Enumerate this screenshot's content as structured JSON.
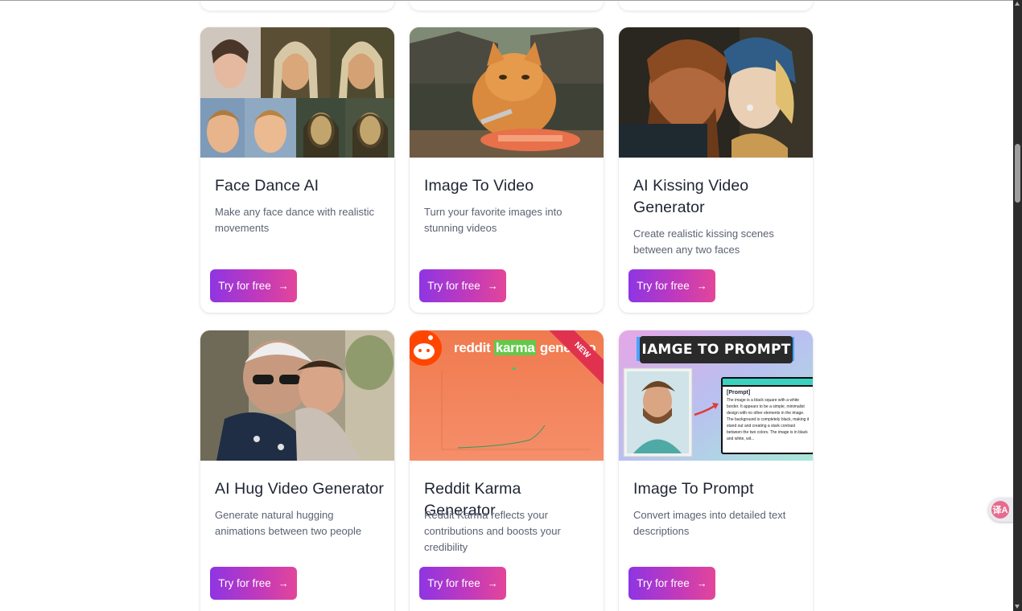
{
  "cards": [
    {
      "title": "Face Dance AI",
      "description": "Make any face dance with realistic movements",
      "button": "Try for free"
    },
    {
      "title": "Image To Video",
      "description": "Turn your favorite images into stunning videos",
      "button": "Try for free"
    },
    {
      "title": "AI Kissing Video Generator",
      "description": "Create realistic kissing scenes between any two faces",
      "button": "Try for free"
    },
    {
      "title": "AI Hug Video Generator",
      "description": "Generate natural hugging animations between two people",
      "button": "Try for free"
    },
    {
      "title": "Reddit Karma Generator",
      "description": "Reddit Karma reflects your contributions and boosts your credibility",
      "button": "Try for free",
      "thumb_text_1": "reddit",
      "thumb_text_2": "karma",
      "thumb_text_3": "generato",
      "badge": "NEW"
    },
    {
      "title": "Image To Prompt",
      "description": "Convert images into detailed text descriptions",
      "button": "Try for free",
      "thumb_banner": "IAMGE TO PROMPT",
      "thumb_prompt_title": "[Prompt]",
      "thumb_prompt_text": "The image is a black square with a white border. It appears to be a simple, minimalist design with no other elements in the image. The background is completely black, making it stand out and creating a stark contrast between the two colors. The image is in black and white, wit..."
    }
  ],
  "translate_fab_label": "译A",
  "colors": {
    "button_gradient_start": "#8e35e3",
    "button_gradient_end": "#e3469a"
  }
}
